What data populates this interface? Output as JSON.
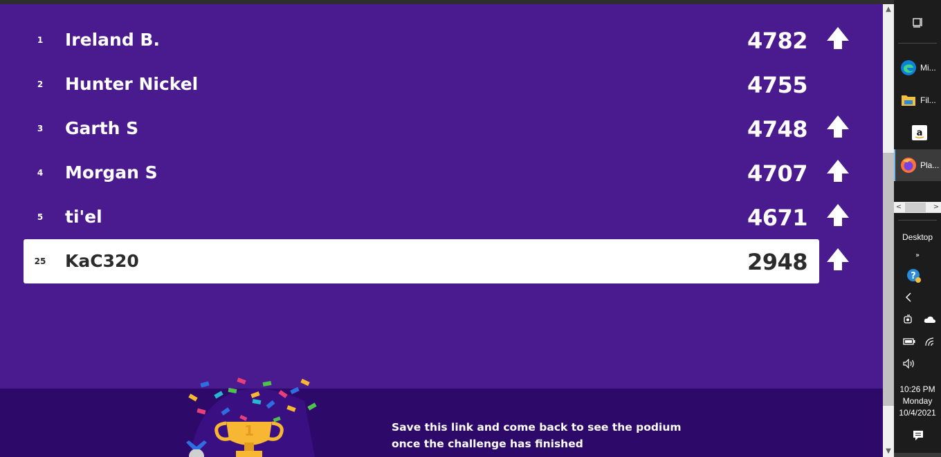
{
  "leaderboard": {
    "rows": [
      {
        "rank": "1",
        "name": "Ireland B.",
        "score": "4782",
        "trend": "up"
      },
      {
        "rank": "2",
        "name": "Hunter Nickel",
        "score": "4755",
        "trend": "none"
      },
      {
        "rank": "3",
        "name": "Garth S",
        "score": "4748",
        "trend": "up"
      },
      {
        "rank": "4",
        "name": "Morgan S",
        "score": "4707",
        "trend": "up"
      },
      {
        "rank": "5",
        "name": "ti'el",
        "score": "4671",
        "trend": "up"
      }
    ],
    "current_player": {
      "rank": "25",
      "name": "KaC320",
      "score": "2948",
      "trend": "up"
    }
  },
  "footer": {
    "message_line1": "Save this link and come back to see the podium",
    "message_line2": "once the challenge has finished",
    "trophy_number": "1"
  },
  "taskbar": {
    "apps": [
      {
        "label": "Mi...",
        "icon": "edge-icon"
      },
      {
        "label": "Fil...",
        "icon": "file-explorer-icon"
      },
      {
        "label": "",
        "icon": "amazon-icon"
      },
      {
        "label": "Pla...",
        "icon": "firefox-icon",
        "active": true
      }
    ],
    "desktop_label": "Desktop",
    "clock": {
      "time": "10:26 PM",
      "day": "Monday",
      "date": "10/4/2021"
    }
  },
  "colors": {
    "page_bg": "#4a1a8f",
    "footer_bg": "#2d0a6a",
    "highlight_row_bg": "#ffffff",
    "taskbar_bg": "#1c1c1c"
  }
}
